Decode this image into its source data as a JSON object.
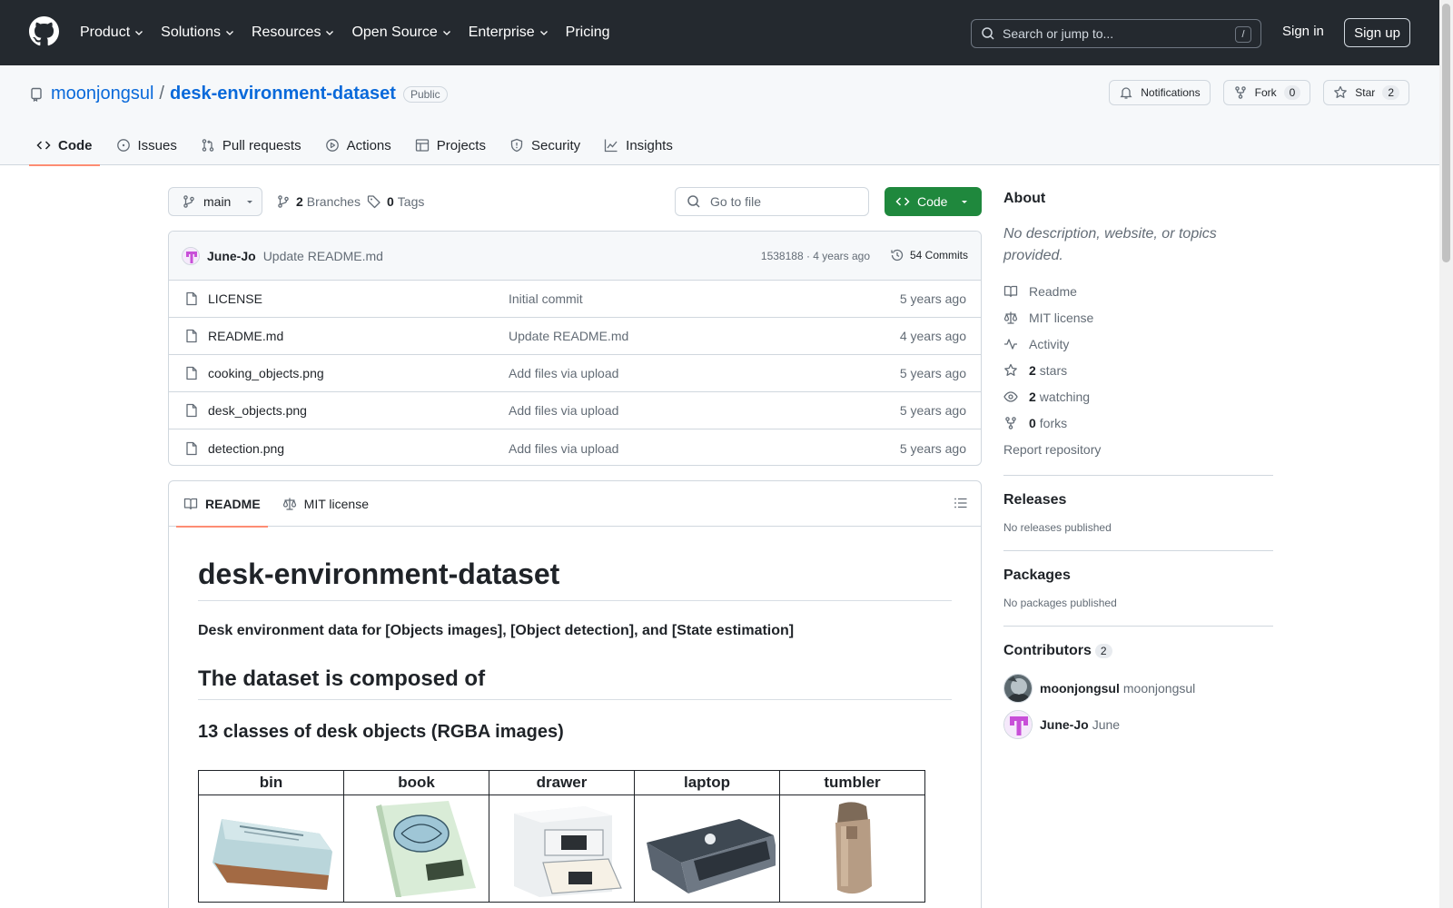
{
  "header": {
    "nav": [
      "Product",
      "Solutions",
      "Resources",
      "Open Source",
      "Enterprise",
      "Pricing"
    ],
    "search_placeholder": "Search or jump to...",
    "search_shortcut": "/",
    "sign_in": "Sign in",
    "sign_up": "Sign up"
  },
  "repo": {
    "owner": "moonjongsul",
    "separator": "/",
    "name": "desk-environment-dataset",
    "visibility": "Public",
    "notifications_label": "Notifications",
    "fork_label": "Fork",
    "fork_count": "0",
    "star_label": "Star",
    "star_count": "2",
    "tabs": [
      "Code",
      "Issues",
      "Pull requests",
      "Actions",
      "Projects",
      "Security",
      "Insights"
    ]
  },
  "toolbar": {
    "branch": "main",
    "branches_count": "2",
    "branches_label": "Branches",
    "tags_count": "0",
    "tags_label": "Tags",
    "goto_placeholder": "Go to file",
    "code_label": "Code"
  },
  "latest_commit": {
    "author": "June-Jo",
    "message": "Update README.md",
    "meta": "1538188 · 4 years ago",
    "commits": "54 Commits"
  },
  "files": [
    {
      "name": "LICENSE",
      "message": "Initial commit",
      "age": "5 years ago"
    },
    {
      "name": "README.md",
      "message": "Update README.md",
      "age": "4 years ago"
    },
    {
      "name": "cooking_objects.png",
      "message": "Add files via upload",
      "age": "5 years ago"
    },
    {
      "name": "desk_objects.png",
      "message": "Add files via upload",
      "age": "5 years ago"
    },
    {
      "name": "detection.png",
      "message": "Add files via upload",
      "age": "5 years ago"
    }
  ],
  "readme": {
    "tab_readme": "README",
    "tab_license": "MIT license",
    "h1": "desk-environment-dataset",
    "intro": "Desk environment data for [Objects images], [Object detection], and [State estimation]",
    "h2": "The dataset is composed of",
    "h3": "13 classes of desk objects (RGBA images)",
    "table_headers": [
      "bin",
      "book",
      "drawer",
      "laptop",
      "tumbler"
    ]
  },
  "about": {
    "title": "About",
    "description": "No description, website, or topics provided.",
    "readme": "Readme",
    "license": "MIT license",
    "activity": "Activity",
    "stars_count": "2",
    "stars_label": "stars",
    "watching_count": "2",
    "watching_label": "watching",
    "forks_count": "0",
    "forks_label": "forks",
    "report": "Report repository"
  },
  "releases": {
    "title": "Releases",
    "empty": "No releases published"
  },
  "packages": {
    "title": "Packages",
    "empty": "No packages published"
  },
  "contributors": {
    "title": "Contributors",
    "count": "2",
    "list": [
      {
        "login": "moonjongsul",
        "name": "moonjongsul"
      },
      {
        "login": "June-Jo",
        "name": "June"
      }
    ]
  }
}
